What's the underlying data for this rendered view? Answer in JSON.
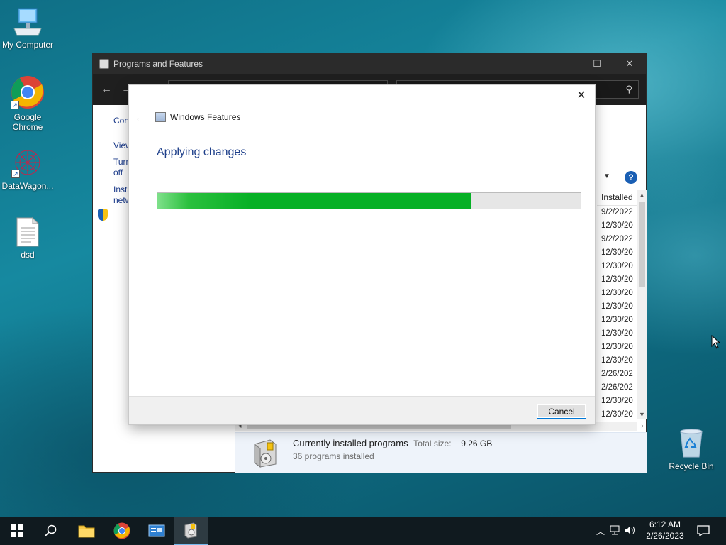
{
  "desktop": {
    "icons": [
      {
        "label": "My Computer",
        "icon": "computer-icon"
      },
      {
        "label": "Google Chrome",
        "icon": "chrome-icon",
        "label_lines": [
          "Google",
          "Chrome"
        ]
      },
      {
        "label": "DataWagon...",
        "icon": "datawagon-icon"
      },
      {
        "label": "dsd",
        "icon": "text-file-icon"
      }
    ],
    "recycle_bin": {
      "label": "Recycle Bin",
      "icon": "recycle-bin-icon"
    }
  },
  "programs_window": {
    "title": "Programs and Features",
    "left_links": [
      "Con",
      "View",
      "Turn",
      "off",
      "Insta",
      "netw"
    ],
    "installed_column": {
      "header": "Installed",
      "values": [
        "9/2/2022",
        "12/30/20",
        "9/2/2022",
        "12/30/20",
        "12/30/20",
        "12/30/20",
        "12/30/20",
        "12/30/20",
        "12/30/20",
        "12/30/20",
        "12/30/20",
        "12/30/20",
        "2/26/202",
        "2/26/202",
        "12/30/20",
        "12/30/20"
      ]
    },
    "details": {
      "title": "Currently installed programs",
      "total_size_label": "Total size:",
      "total_size_value": "9.26 GB",
      "count_text": "36 programs installed"
    }
  },
  "windows_features_dialog": {
    "title": "Windows Features",
    "heading": "Applying changes",
    "progress_fraction": 0.74,
    "cancel_label": "Cancel",
    "progress_color": "#06b025"
  },
  "taskbar": {
    "items": [
      "start-icon",
      "search-icon",
      "file-explorer-icon",
      "chrome-icon",
      "server-manager-icon",
      "programs-features-icon"
    ],
    "clock": {
      "time": "6:12 AM",
      "date": "2/26/2023"
    }
  }
}
